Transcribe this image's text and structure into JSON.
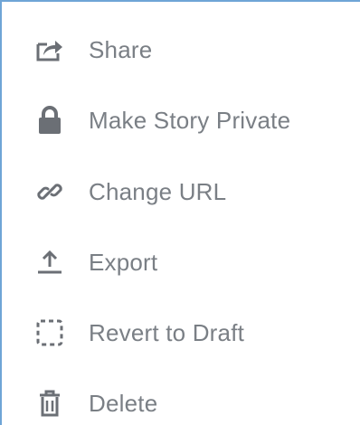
{
  "menu": {
    "icon_color": "#6b6f75",
    "text_color": "#7a7f85",
    "border_color": "#6fa5d6",
    "items": [
      {
        "label": "Share",
        "icon": "share-icon"
      },
      {
        "label": "Make Story Private",
        "icon": "lock-icon"
      },
      {
        "label": "Change URL",
        "icon": "link-icon"
      },
      {
        "label": "Export",
        "icon": "export-icon"
      },
      {
        "label": "Revert to Draft",
        "icon": "dashed-square-icon"
      },
      {
        "label": "Delete",
        "icon": "trash-icon"
      }
    ]
  }
}
